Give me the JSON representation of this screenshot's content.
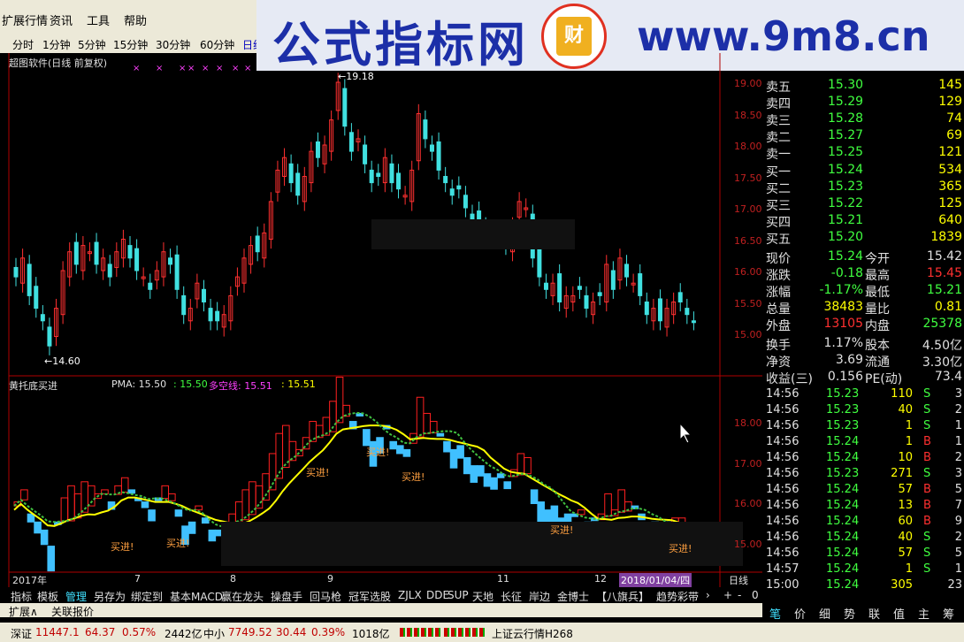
{
  "menu": {
    "items": [
      "扩展行情",
      "资讯",
      "工具",
      "帮助"
    ]
  },
  "timeframes": [
    "分时",
    "1分钟",
    "5分钟",
    "15分钟",
    "30分钟",
    "60分钟",
    "日线"
  ],
  "banner": {
    "title": "公式指标网",
    "url": "www.9m8.cn"
  },
  "chart": {
    "title": "超图软件(日线 前复权)",
    "high_label": "←19.18",
    "low_label": "←14.60",
    "y_ticks": [
      "19.00",
      "18.50",
      "18.00",
      "17.50",
      "17.00",
      "16.50",
      "16.00",
      "15.50",
      "15.00"
    ],
    "watermark": "公式指标网"
  },
  "indicator": {
    "title": "黄托底买进",
    "pma_label": "PMA: 15.50",
    "val2": ": 15.50",
    "dkx_label": "多空线: 15.51",
    "val4": ": 15.51",
    "y_ticks": [
      "18.00",
      "17.00",
      "16.00",
      "15.00"
    ],
    "buy_label": "买进!"
  },
  "axis": {
    "labels": [
      "2017年",
      "7",
      "8",
      "9",
      "11",
      "12",
      "2018/01/04/四"
    ],
    "period": "日线"
  },
  "tabs_bar": [
    "指标",
    "模板",
    "管理",
    "另存为",
    "绑定到",
    "基本MACD",
    "赢在龙头",
    "操盘手",
    "回马枪",
    "冠军选股",
    "ZJLX",
    "DDE",
    "SUP",
    "天地",
    "长征",
    "岸边",
    "金博士",
    "【八旗兵】",
    "趋势彩带"
  ],
  "sub_bar": [
    "扩展∧",
    "关联报价"
  ],
  "orderbook": {
    "sell": [
      {
        "name": "卖五",
        "price": "15.30",
        "vol": "145"
      },
      {
        "name": "卖四",
        "price": "15.29",
        "vol": "129"
      },
      {
        "name": "卖三",
        "price": "15.28",
        "vol": "74"
      },
      {
        "name": "卖二",
        "price": "15.27",
        "vol": "69"
      },
      {
        "name": "卖一",
        "price": "15.25",
        "vol": "121"
      }
    ],
    "buy": [
      {
        "name": "买一",
        "price": "15.24",
        "vol": "534"
      },
      {
        "name": "买二",
        "price": "15.23",
        "vol": "365"
      },
      {
        "name": "买三",
        "price": "15.22",
        "vol": "125"
      },
      {
        "name": "买四",
        "price": "15.21",
        "vol": "640"
      },
      {
        "name": "买五",
        "price": "15.20",
        "vol": "1839"
      }
    ]
  },
  "quote": [
    [
      "现价",
      "15.24",
      "今开",
      "15.42"
    ],
    [
      "涨跌",
      "-0.18",
      "最高",
      "15.45"
    ],
    [
      "涨幅",
      "-1.17%",
      "最低",
      "15.21"
    ],
    [
      "总量",
      "38483",
      "量比",
      "0.81"
    ],
    [
      "外盘",
      "13105",
      "内盘",
      "25378"
    ],
    [
      "换手",
      "1.17%",
      "股本",
      "4.50亿"
    ],
    [
      "净资",
      "3.69",
      "流通",
      "3.30亿"
    ],
    [
      "收益(三)",
      "0.156",
      "PE(动)",
      "73.4"
    ]
  ],
  "ticks": [
    [
      "14:56",
      "15.23",
      "110",
      "S",
      "3"
    ],
    [
      "14:56",
      "15.23",
      "40",
      "S",
      "2"
    ],
    [
      "14:56",
      "15.23",
      "1",
      "S",
      "1"
    ],
    [
      "14:56",
      "15.24",
      "1",
      "B",
      "1"
    ],
    [
      "14:56",
      "15.24",
      "10",
      "B",
      "2"
    ],
    [
      "14:56",
      "15.23",
      "271",
      "S",
      "3"
    ],
    [
      "14:56",
      "15.24",
      "57",
      "B",
      "5"
    ],
    [
      "14:56",
      "15.24",
      "13",
      "B",
      "7"
    ],
    [
      "14:56",
      "15.24",
      "60",
      "B",
      "9"
    ],
    [
      "14:56",
      "15.24",
      "40",
      "S",
      "2"
    ],
    [
      "14:56",
      "15.24",
      "57",
      "S",
      "5"
    ],
    [
      "14:57",
      "15.24",
      "1",
      "S",
      "1"
    ],
    [
      "15:00",
      "15.24",
      "305",
      "",
      "23"
    ]
  ],
  "right_tabs": [
    "笔",
    "价",
    "细",
    "势",
    "联",
    "值",
    "主",
    "筹"
  ],
  "status": {
    "sz_label": "深证",
    "sz_val": "11447.1",
    "sz_chg": "64.37",
    "sz_pct": "0.57%",
    "sz_amt": "2442亿",
    "zx_label": "中小",
    "zx_val": "7749.52",
    "zx_chg": "30.44",
    "zx_pct": "0.39%",
    "zx_amt": "1018亿",
    "cloud": "上证云行情H268"
  },
  "colors": {
    "up": "#ff3030",
    "down": "#40e0e0",
    "price": "#40ff40",
    "yellow": "#ffff00",
    "grid": "#b00000"
  }
}
